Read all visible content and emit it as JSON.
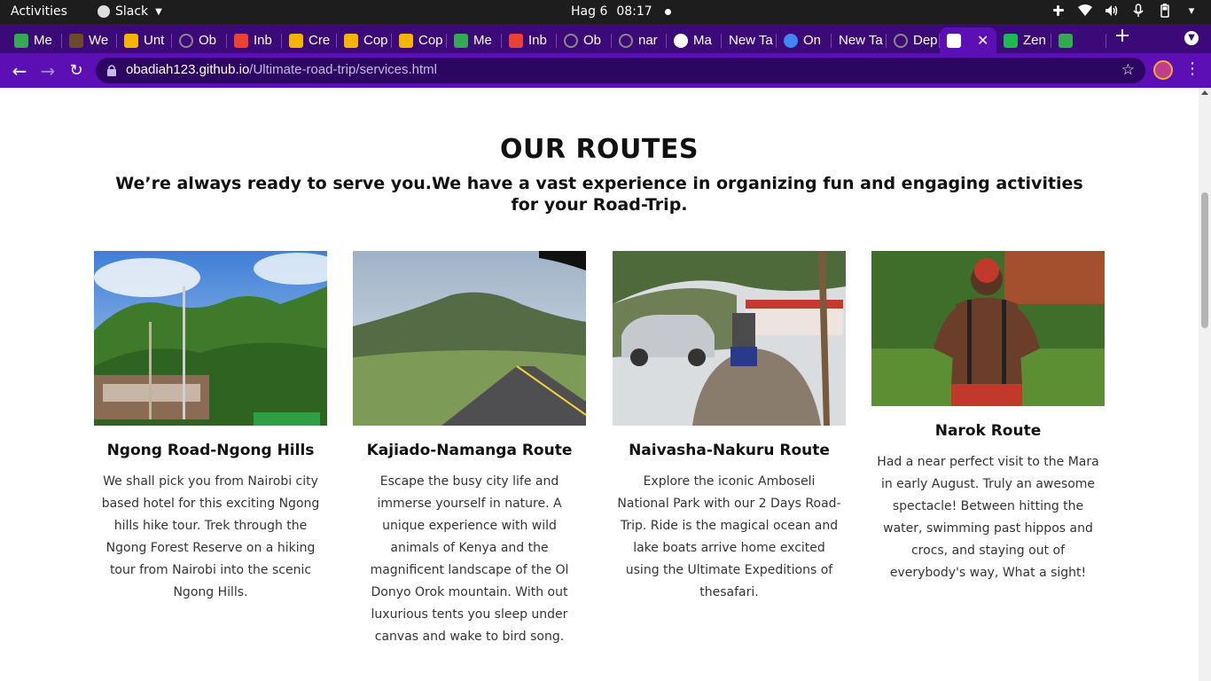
{
  "system_bar": {
    "activities": "Activities",
    "app_name": "Slack",
    "date": "Hag 6",
    "time": "08:17"
  },
  "browser": {
    "tabs": [
      {
        "label": "Me",
        "icon": "google-meet-icon",
        "color": "#34a853"
      },
      {
        "label": "We",
        "icon": "leaf-icon",
        "color": "#6b4b2a"
      },
      {
        "label": "Unt",
        "icon": "google-slides-icon",
        "color": "#f4b400"
      },
      {
        "label": "Ob",
        "icon": "github-icon",
        "color": "#222222"
      },
      {
        "label": "Inb",
        "icon": "gmail-icon",
        "color": "#ea4335"
      },
      {
        "label": "Cre",
        "icon": "doc-icon",
        "color": "#f4b400"
      },
      {
        "label": "Cop",
        "icon": "google-slides-icon",
        "color": "#f4b400"
      },
      {
        "label": "Cop",
        "icon": "google-slides-icon",
        "color": "#f4b400"
      },
      {
        "label": "Me",
        "icon": "google-meet-icon",
        "color": "#34a853"
      },
      {
        "label": "Inb",
        "icon": "gmail-icon",
        "color": "#ea4335"
      },
      {
        "label": "Ob",
        "icon": "github-icon",
        "color": "#222222"
      },
      {
        "label": "nar",
        "icon": "github-icon",
        "color": "#222222"
      },
      {
        "label": "Ma",
        "icon": "globe-icon",
        "color": "#ffffff"
      },
      {
        "label": "New Ta",
        "icon": "",
        "color": ""
      },
      {
        "label": "On",
        "icon": "chrome-icon",
        "color": "#4285f4"
      },
      {
        "label": "New Ta",
        "icon": "",
        "color": ""
      },
      {
        "label": "Dep",
        "icon": "github-icon",
        "color": "#222222"
      },
      {
        "label": "",
        "icon": "page-icon",
        "color": "#ffffff",
        "active": true
      },
      {
        "label": "Zen",
        "icon": "zendesk-icon",
        "color": "#1db954"
      },
      {
        "label": "",
        "icon": "google-meet-icon",
        "color": "#34a853"
      }
    ],
    "url_host": "obadiah123.github.io",
    "url_path": "/Ultimate-road-trip/services.html"
  },
  "page": {
    "heading": "OUR ROUTES",
    "subheading": "We’re always ready to serve you.We have a vast experience in organizing fun and engaging activities for your Road-Trip.",
    "routes": [
      {
        "title": "Ngong Road-Ngong Hills",
        "text": "We shall pick you from Nairobi city based hotel for this exciting Ngong hills hike tour. Trek through the Ngong Forest Reserve on a hiking tour from Nairobi into the scenic Ngong Hills."
      },
      {
        "title": "Kajiado-Namanga Route",
        "text": "Escape the busy city life and immerse yourself in nature. A unique experience with wild animals of Kenya and the magnificent landscape of the Ol Donyo Orok mountain. With out luxurious tents you sleep under canvas and wake to bird song."
      },
      {
        "title": "Naivasha-Nakuru Route",
        "text": "Explore the iconic Amboseli National Park with our 2 Days Road-Trip. Ride is the magical ocean and lake boats arrive home excited using the Ultimate Expeditions of thesafari."
      },
      {
        "title": "Narok Route",
        "text": "Had a near perfect visit to the Mara in early August. Truly an awesome spectacle! Between hitting the water, swimming past hippos and crocs, and staying out of everybody's way, What a sight!"
      }
    ]
  },
  "colors": {
    "tabstrip": "#3b0a78",
    "toolbar": "#5b0fb5",
    "omnibox": "#2c0660"
  }
}
